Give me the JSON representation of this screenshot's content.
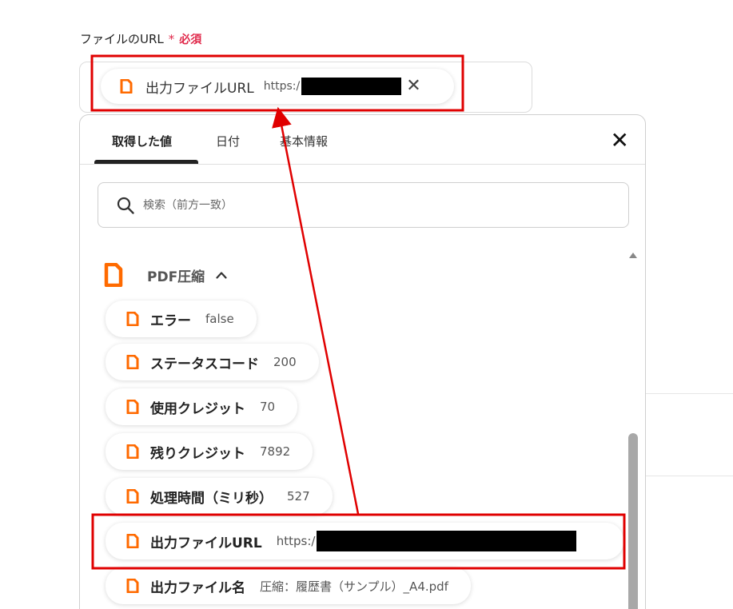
{
  "field": {
    "label": "ファイルのURL",
    "required_star": "*",
    "required_text": "必須"
  },
  "selected_chip": {
    "label": "出力ファイルURL",
    "value": "https:/",
    "remove_glyph": "✕"
  },
  "panel": {
    "tabs": [
      {
        "label": "取得した値",
        "active": true
      },
      {
        "label": "日付",
        "active": false
      },
      {
        "label": "基本情報",
        "active": false
      }
    ],
    "close_glyph": "✕",
    "search": {
      "placeholder": "検索（前方一致）"
    },
    "group": {
      "label": "PDF圧縮",
      "expanded": true
    },
    "items": [
      {
        "label": "エラー",
        "value": "false"
      },
      {
        "label": "ステータスコード",
        "value": "200"
      },
      {
        "label": "使用クレジット",
        "value": "70"
      },
      {
        "label": "残りクレジット",
        "value": "7892"
      },
      {
        "label": "処理時間（ミリ秒）",
        "value": "527"
      },
      {
        "label": "出力ファイルURL",
        "value": "https:/"
      },
      {
        "label": "出力ファイル名",
        "value": "圧縮：履歴書（サンプル）_A4.pdf"
      }
    ]
  },
  "colors": {
    "accent_orange": "#ff6a00",
    "required_red": "#e0284a",
    "annotation_red": "#e00000"
  },
  "icons": {
    "item_icon": "document-icon",
    "group_icon": "document-icon",
    "search_icon": "search-icon"
  }
}
